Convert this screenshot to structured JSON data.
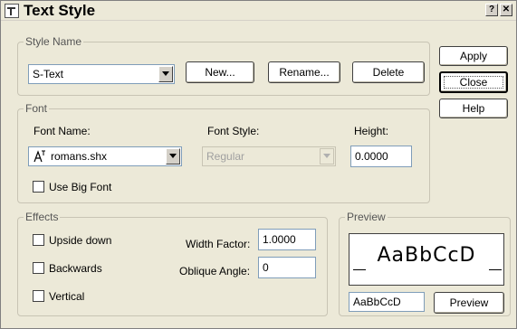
{
  "window": {
    "title": "Text Style",
    "help_glyph": "?",
    "close_glyph": "✕"
  },
  "style_name": {
    "group_label": "Style Name",
    "selected": "S-Text",
    "new_label": "New...",
    "rename_label": "Rename...",
    "delete_label": "Delete"
  },
  "side_buttons": {
    "apply_label": "Apply",
    "close_label": "Close",
    "help_label": "Help"
  },
  "font": {
    "group_label": "Font",
    "font_name_label": "Font Name:",
    "font_name_value": "romans.shx",
    "font_name_icon": "cad-font-icon",
    "font_style_label": "Font Style:",
    "font_style_value": "Regular",
    "height_label": "Height:",
    "height_value": "0.0000",
    "big_font_label": "Use Big Font"
  },
  "effects": {
    "group_label": "Effects",
    "upside_down_label": "Upside down",
    "backwards_label": "Backwards",
    "vertical_label": "Vertical",
    "width_factor_label": "Width Factor:",
    "width_factor_value": "1.0000",
    "oblique_angle_label": "Oblique Angle:",
    "oblique_angle_value": "0"
  },
  "preview": {
    "group_label": "Preview",
    "sample_display": "AaBbCcD",
    "sample_input": "AaBbCcD",
    "button_label": "Preview"
  }
}
